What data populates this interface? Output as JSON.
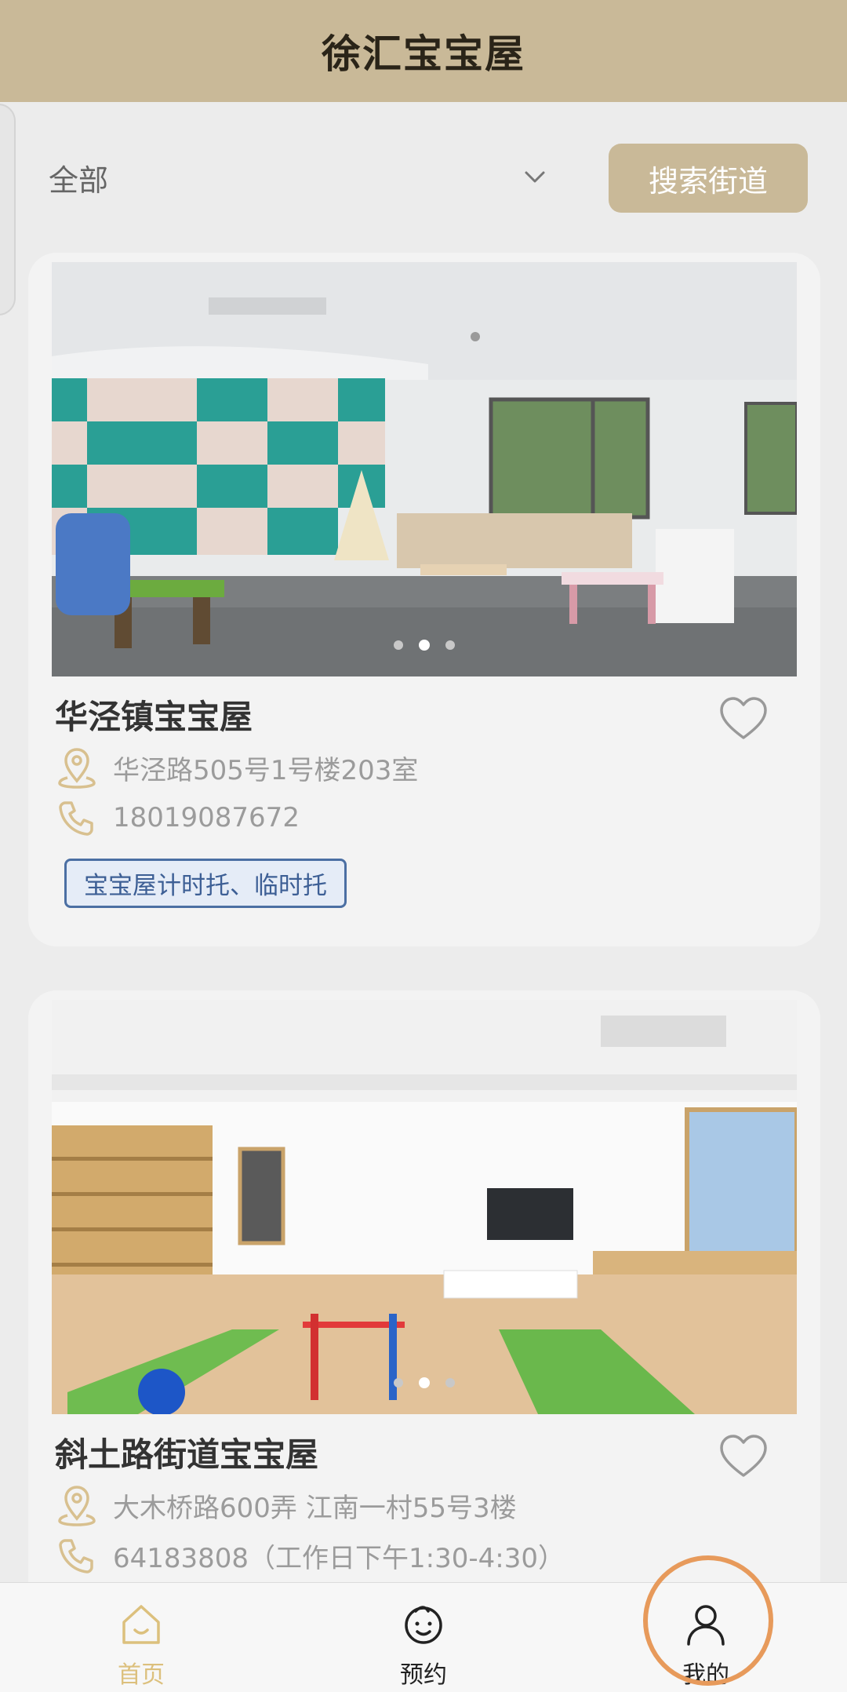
{
  "header": {
    "title": "徐汇宝宝屋"
  },
  "filter": {
    "selected": "全部",
    "search_button": "搜索街道"
  },
  "cards": [
    {
      "name": "华泾镇宝宝屋",
      "address": "华泾路505号1号楼203室",
      "phone": "18019087672",
      "tag": "宝宝屋计时托、临时托",
      "favorited": false
    },
    {
      "name": "斜土路街道宝宝屋",
      "address": "大木桥路600弄 江南一村55号3楼",
      "phone": "64183808（工作日下午1:30-4:30）",
      "favorited": false
    }
  ],
  "nav": {
    "items": [
      {
        "label": "首页",
        "icon": "home-icon",
        "active": true
      },
      {
        "label": "预约",
        "icon": "baby-face-icon",
        "active": false
      },
      {
        "label": "我的",
        "icon": "person-icon",
        "active": false
      }
    ]
  },
  "colors": {
    "header_bg": "#c9b998",
    "accent_gold": "#dcc07d",
    "tag_blue": "#4b6fa3",
    "highlight_circle": "#e79a5b"
  }
}
